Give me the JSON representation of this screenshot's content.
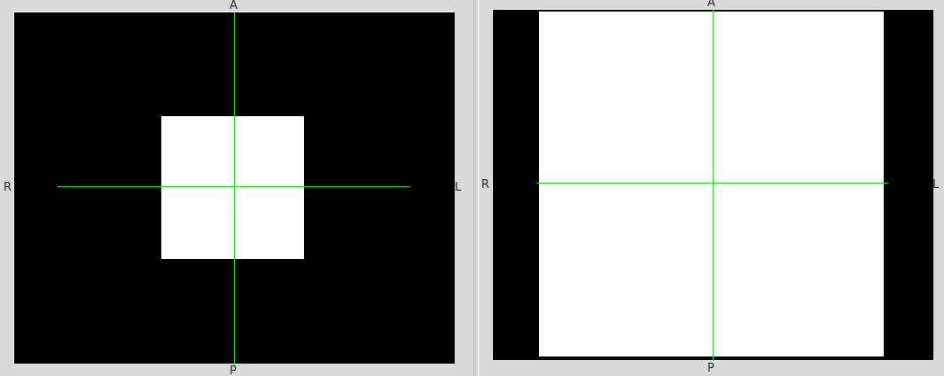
{
  "viewports": [
    {
      "id": "left",
      "labels": {
        "top": "A",
        "bottom": "P",
        "left": "R",
        "right": "L"
      }
    },
    {
      "id": "right",
      "labels": {
        "top": "A",
        "bottom": "P",
        "left": "R",
        "right": "L"
      }
    }
  ],
  "colors": {
    "background": "#d6d6d6",
    "image_background": "#000000",
    "image_content": "#ffffff",
    "crosshair": "#2cd52c",
    "label_text": "#2a2a2a"
  }
}
